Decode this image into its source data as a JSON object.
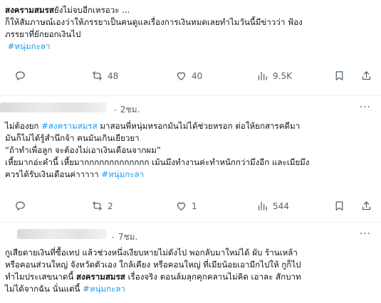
{
  "post1": {
    "line1_bold": "สงครามสมรส",
    "line1_rest": "ยังไม่จบอีกเหรอวะ ...",
    "line2": "ก็ให้สัมภาษณ์เองว่าให้ภรรยาเป็นคนดูแลเรื่องการเงินหมดเลยทำไมวันนี้มีข่าวว่า ฟ้อง",
    "line3": "ภรรยาที่ยักยอกเงินไป",
    "hashtag": "#หนุ่มกะลา",
    "stats": {
      "reposts": "48",
      "likes": "40",
      "views": "9.5K"
    }
  },
  "reply1": {
    "time": "2ชม.",
    "l1_a": "ไม่ต้องยก ",
    "l1_tag": "#สงครามสมรส",
    "l1_b": " มาสอนพี่หนุ่มหรอกมันไม่ได้ช่วยหรอก ต่อให้ยกสารคดีมา",
    "line2": "มันก็ไม่ได้รู้สำนึกจ้า คนมันเกินเยียวยา",
    "line3": "“ถ้าทำเพื่อลูก จะต้องไม่เอาเงินเดือนจากผม”",
    "line4": "เหี้ยมากอ่ะคำนี้ เหี้ยมากกกกกกกกกกกกก เม้นมึงทำงานค่ะทำหนักกว่ามึงอีก และเมียมึง",
    "line5": "ควรได้รับเงินเดือนค่าาาาา ",
    "hashtag": "#หนุ่มกะลา",
    "stats": {
      "reposts": "2",
      "likes": "1",
      "views": "544"
    }
  },
  "reply2": {
    "time": "7ชม.",
    "line1": "กูเสียดายเงินที่ซื้อเทป แล้วช่วงหนึ่งเงียบหายไม่ดังไป พอกลับมาใหม่ได้ ผับ ร้านเหล้า",
    "line2": "หรือคอนส่วนใหญ่ จังหวัดตัวเอง ใกล้เคียง หรือคอนใหญ่ ที่เมียน้อยเอามีกไปให้ กูก็ไป",
    "l3_a": "ทำไมประเสขนาดนี้ ",
    "l3_bold": "สงครามสมรส",
    "l3_b": " เรื่องจริง ตอนล้มลุกคุกคลานไม่คิด เอาละ สักบาท",
    "l4_a": "ไม่ได้จากฉัน นั่นแต่นี้ ",
    "hashtag": "#หนุ่มกะลา"
  },
  "ui": {
    "more": "···"
  },
  "colors": {
    "accent": "#1d9bf0",
    "muted": "#536471",
    "text": "#0f1419"
  }
}
